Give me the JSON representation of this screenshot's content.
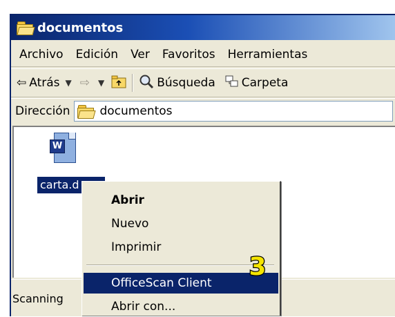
{
  "window": {
    "title": "documentos"
  },
  "menu": [
    "Archivo",
    "Edición",
    "Ver",
    "Favoritos",
    "Herramientas"
  ],
  "toolbar": {
    "back": "Atrás",
    "search": "Búsqueda",
    "folders": "Carpeta"
  },
  "address": {
    "label": "Dirección",
    "value": "documentos"
  },
  "file": {
    "name": "carta.d"
  },
  "status": {
    "text": "Scanning"
  },
  "context_menu": {
    "items": [
      "Abrir",
      "Nuevo",
      "Imprimir",
      "OfficeScan Client",
      "Abrir con..."
    ],
    "selected": "OfficeScan Client"
  },
  "badge": {
    "number": "3"
  },
  "icons": [
    "folder-icon",
    "back-arrow-icon",
    "forward-arrow-icon",
    "up-folder-icon",
    "search-icon",
    "folders-icon",
    "word-document-icon"
  ],
  "colors": {
    "selection": "#0a246a",
    "titlebar": "#0a246a",
    "badge": "#f5e400"
  }
}
